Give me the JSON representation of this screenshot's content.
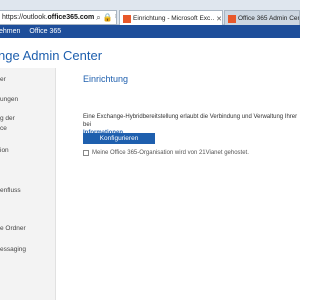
{
  "browser": {
    "url_prefix": "https://outlook.",
    "url_host": "office365.com",
    "tabs": [
      {
        "label": "Einrichtung - Microsoft Exc…",
        "active": true
      },
      {
        "label": "Office 365 Admin Center",
        "active": false
      }
    ]
  },
  "o365_bar": {
    "items": [
      "ehmen",
      "Office 365"
    ]
  },
  "app": {
    "title": "nge Admin Center"
  },
  "sidebar": {
    "items": [
      {
        "text": "er"
      },
      {
        "text": "ungen"
      },
      {
        "text": "g der"
      },
      {
        "text": "ce"
      },
      {
        "text": "ion"
      },
      {
        "text": "enfluss"
      },
      {
        "text": "e Ordner"
      },
      {
        "text": "essaging"
      }
    ]
  },
  "main": {
    "title": "Einrichtung",
    "description": "Eine Exchange-Hybridbereitstellung erlaubt die Verbindung und Verwaltung Ihrer bei",
    "info_link": "Informationen",
    "configure_button": "Konfigurieren",
    "checkbox_label": "Meine Office 365-Organisation wird von 21Vianet gehostet."
  },
  "colors": {
    "accent": "#1e5fae",
    "o365_bar": "#1e4e9a",
    "sidebar_bg": "#f3f3f3"
  }
}
